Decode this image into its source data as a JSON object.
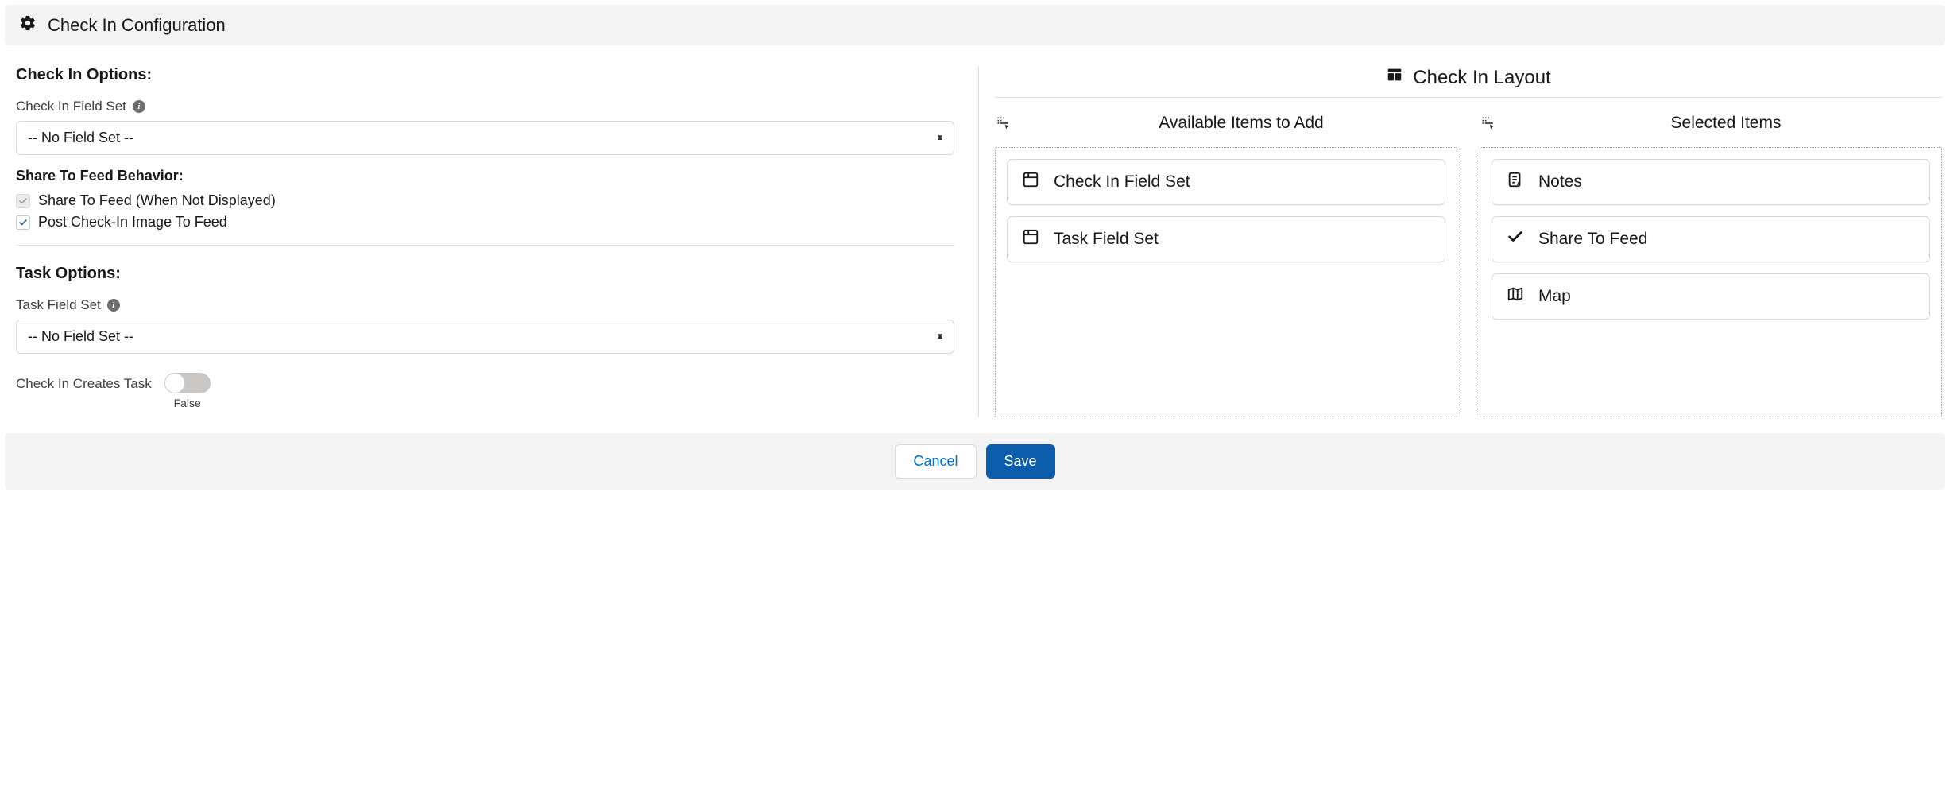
{
  "header": {
    "title": "Check In Configuration"
  },
  "left": {
    "check_in_options_heading": "Check In Options:",
    "check_in_field_set_label": "Check In Field Set",
    "check_in_field_set_value": "-- No Field Set --",
    "share_to_feed_behavior_heading": "Share To Feed Behavior:",
    "share_to_feed_label": "Share To Feed (When Not Displayed)",
    "post_image_label": "Post Check-In Image To Feed",
    "task_options_heading": "Task Options:",
    "task_field_set_label": "Task Field Set",
    "task_field_set_value": "-- No Field Set --",
    "creates_task_label": "Check In Creates Task",
    "creates_task_state_label": "False"
  },
  "right": {
    "layout_title": "Check In Layout",
    "available_header": "Available Items to Add",
    "selected_header": "Selected Items",
    "available_items": {
      "0": "Check In Field Set",
      "1": "Task Field Set"
    },
    "selected_items": {
      "0": "Notes",
      "1": "Share To Feed",
      "2": "Map"
    }
  },
  "footer": {
    "cancel_label": "Cancel",
    "save_label": "Save"
  }
}
